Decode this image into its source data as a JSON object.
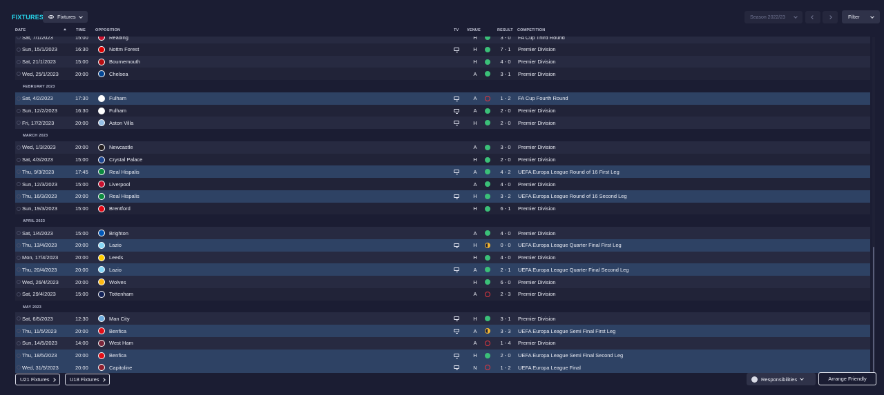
{
  "header": {
    "title": "FIXTURES",
    "view_label": "Fixtures",
    "season": "Season 2022/23",
    "filter_label": "Filter"
  },
  "columns": {
    "date": "DATE",
    "time": "TIME",
    "opposition": "OPPOSITION",
    "tv": "TV",
    "venue": "VENUE",
    "result": "RESULT",
    "competition": "COMPETITION"
  },
  "colors": {
    "accent": "#27d8ee",
    "win": "#3bbf78",
    "loss": "#e0373f",
    "draw": "#f1b533",
    "highlight_row": "#2e4264"
  },
  "rows": [
    {
      "kind": "fixture",
      "date": "Sat, 7/1/2023",
      "time": "15:00",
      "opp": "Reading",
      "tv": false,
      "venue": "H",
      "outcome": "win",
      "result": "3 - 0",
      "comp": "FA Cup Third Round",
      "badge": "#c8102e",
      "hl": false
    },
    {
      "kind": "fixture",
      "date": "Sun, 15/1/2023",
      "time": "16:30",
      "opp": "Nottm Forest",
      "tv": true,
      "venue": "H",
      "outcome": "win",
      "result": "7 - 1",
      "comp": "Premier Division",
      "badge": "#dd0000",
      "hl": false
    },
    {
      "kind": "fixture",
      "date": "Sat, 21/1/2023",
      "time": "15:00",
      "opp": "Bournemouth",
      "tv": false,
      "venue": "H",
      "outcome": "win",
      "result": "4 - 0",
      "comp": "Premier Division",
      "badge": "#b50e12",
      "hl": false
    },
    {
      "kind": "fixture",
      "date": "Wed, 25/1/2023",
      "time": "20:00",
      "opp": "Chelsea",
      "tv": false,
      "venue": "A",
      "outcome": "win",
      "result": "3 - 1",
      "comp": "Premier Division",
      "badge": "#034694",
      "hl": false
    },
    {
      "kind": "month",
      "label": "FEBRUARY 2023"
    },
    {
      "kind": "fixture",
      "date": "Sat, 4/2/2023",
      "time": "17:30",
      "opp": "Fulham",
      "tv": true,
      "venue": "A",
      "outcome": "loss",
      "result": "1 - 2",
      "comp": "FA Cup Fourth Round",
      "badge": "#ffffff",
      "hl": true
    },
    {
      "kind": "fixture",
      "date": "Sun, 12/2/2023",
      "time": "16:30",
      "opp": "Fulham",
      "tv": true,
      "venue": "A",
      "outcome": "win",
      "result": "2 - 0",
      "comp": "Premier Division",
      "badge": "#ffffff",
      "hl": false
    },
    {
      "kind": "fixture",
      "date": "Fri, 17/2/2023",
      "time": "20:00",
      "opp": "Aston Villa",
      "tv": true,
      "venue": "H",
      "outcome": "win",
      "result": "2 - 0",
      "comp": "Premier Division",
      "badge": "#95bfe5",
      "hl": false
    },
    {
      "kind": "month",
      "label": "MARCH 2023"
    },
    {
      "kind": "fixture",
      "date": "Wed, 1/3/2023",
      "time": "20:00",
      "opp": "Newcastle",
      "tv": false,
      "venue": "A",
      "outcome": "win",
      "result": "3 - 0",
      "comp": "Premier Division",
      "badge": "#241f20",
      "hl": false
    },
    {
      "kind": "fixture",
      "date": "Sat, 4/3/2023",
      "time": "15:00",
      "opp": "Crystal Palace",
      "tv": false,
      "venue": "H",
      "outcome": "win",
      "result": "2 - 0",
      "comp": "Premier Division",
      "badge": "#1b458f",
      "hl": false
    },
    {
      "kind": "fixture",
      "date": "Thu, 9/3/2023",
      "time": "17:45",
      "opp": "Real Hispalis",
      "tv": true,
      "venue": "A",
      "outcome": "win",
      "result": "4 - 2",
      "comp": "UEFA Europa League Round of 16 First Leg",
      "badge": "#0b8a3e",
      "hl": true
    },
    {
      "kind": "fixture",
      "date": "Sun, 12/3/2023",
      "time": "15:00",
      "opp": "Liverpool",
      "tv": false,
      "venue": "A",
      "outcome": "win",
      "result": "4 - 0",
      "comp": "Premier Division",
      "badge": "#c8102e",
      "hl": false
    },
    {
      "kind": "fixture",
      "date": "Thu, 16/3/2023",
      "time": "20:00",
      "opp": "Real Hispalis",
      "tv": true,
      "venue": "H",
      "outcome": "win",
      "result": "3 - 2",
      "comp": "UEFA Europa League Round of 16 Second Leg",
      "badge": "#0b8a3e",
      "hl": true
    },
    {
      "kind": "fixture",
      "date": "Sun, 19/3/2023",
      "time": "15:00",
      "opp": "Brentford",
      "tv": false,
      "venue": "H",
      "outcome": "win",
      "result": "6 - 1",
      "comp": "Premier Division",
      "badge": "#e30613",
      "hl": false
    },
    {
      "kind": "month",
      "label": "APRIL 2023"
    },
    {
      "kind": "fixture",
      "date": "Sat, 1/4/2023",
      "time": "15:00",
      "opp": "Brighton",
      "tv": false,
      "venue": "A",
      "outcome": "win",
      "result": "4 - 0",
      "comp": "Premier Division",
      "badge": "#0057b8",
      "hl": false
    },
    {
      "kind": "fixture",
      "date": "Thu, 13/4/2023",
      "time": "20:00",
      "opp": "Lazio",
      "tv": true,
      "venue": "H",
      "outcome": "draw",
      "result": "0 - 0",
      "comp": "UEFA Europa League Quarter Final First Leg",
      "badge": "#87d8f7",
      "hl": true
    },
    {
      "kind": "fixture",
      "date": "Mon, 17/4/2023",
      "time": "20:00",
      "opp": "Leeds",
      "tv": false,
      "venue": "H",
      "outcome": "win",
      "result": "4 - 0",
      "comp": "Premier Division",
      "badge": "#ffcd00",
      "hl": false
    },
    {
      "kind": "fixture",
      "date": "Thu, 20/4/2023",
      "time": "20:00",
      "opp": "Lazio",
      "tv": true,
      "venue": "A",
      "outcome": "win",
      "result": "2 - 1",
      "comp": "UEFA Europa League Quarter Final Second Leg",
      "badge": "#87d8f7",
      "hl": true
    },
    {
      "kind": "fixture",
      "date": "Wed, 26/4/2023",
      "time": "20:00",
      "opp": "Wolves",
      "tv": false,
      "venue": "H",
      "outcome": "win",
      "result": "6 - 0",
      "comp": "Premier Division",
      "badge": "#fdb913",
      "hl": false
    },
    {
      "kind": "fixture",
      "date": "Sat, 29/4/2023",
      "time": "15:00",
      "opp": "Tottenham",
      "tv": false,
      "venue": "A",
      "outcome": "loss",
      "result": "2 - 3",
      "comp": "Premier Division",
      "badge": "#132257",
      "hl": false
    },
    {
      "kind": "month",
      "label": "MAY 2023"
    },
    {
      "kind": "fixture",
      "date": "Sat, 6/5/2023",
      "time": "12:30",
      "opp": "Man City",
      "tv": true,
      "venue": "H",
      "outcome": "win",
      "result": "3 - 1",
      "comp": "Premier Division",
      "badge": "#6cabdd",
      "hl": false
    },
    {
      "kind": "fixture",
      "date": "Thu, 11/5/2023",
      "time": "20:00",
      "opp": "Benfica",
      "tv": true,
      "venue": "A",
      "outcome": "draw",
      "result": "3 - 3",
      "comp": "UEFA Europa League Semi Final First Leg",
      "badge": "#e20e17",
      "hl": true
    },
    {
      "kind": "fixture",
      "date": "Sun, 14/5/2023",
      "time": "14:00",
      "opp": "West Ham",
      "tv": false,
      "venue": "A",
      "outcome": "loss",
      "result": "1 - 4",
      "comp": "Premier Division",
      "badge": "#7a263a",
      "hl": false
    },
    {
      "kind": "fixture",
      "date": "Thu, 18/5/2023",
      "time": "20:00",
      "opp": "Benfica",
      "tv": true,
      "venue": "H",
      "outcome": "win",
      "result": "2 - 0",
      "comp": "UEFA Europa League Semi Final Second Leg",
      "badge": "#e20e17",
      "hl": true
    },
    {
      "kind": "fixture",
      "date": "Wed, 31/5/2023",
      "time": "20:00",
      "opp": "Capitoline",
      "tv": true,
      "venue": "N",
      "outcome": "loss",
      "result": "1 - 2",
      "comp": "UEFA Europa League Final",
      "badge": "#8e1f2f",
      "hl": true
    }
  ],
  "footer": {
    "u21_label": "U21 Fixtures",
    "u18_label": "U18 Fixtures",
    "responsibilities_label": "Responsibilities",
    "arrange_label": "Arrange Friendly"
  }
}
